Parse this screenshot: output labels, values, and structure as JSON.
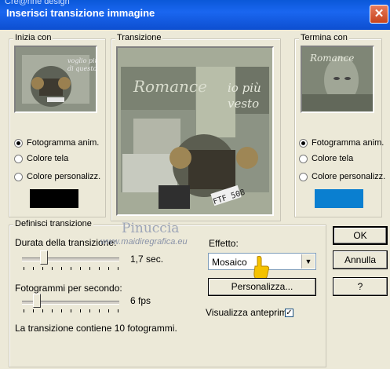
{
  "window": {
    "background_title": "Cre@nne design",
    "title": "Inserisci transizione immagine",
    "close_glyph": "✕"
  },
  "start_group": {
    "legend": "Inizia con",
    "preview_texts": [
      "voglio più",
      "di questo"
    ],
    "options": [
      "Fotogramma anim.",
      "Colore tela",
      "Colore personalizz."
    ],
    "selected_index": 0,
    "swatch_color": "#000000"
  },
  "transition_group": {
    "legend": "Transizione",
    "preview_texts": [
      "Romance",
      "io più",
      "vesto",
      "FTF 508"
    ]
  },
  "end_group": {
    "legend": "Termina con",
    "preview_text": "Romance",
    "options": [
      "Fotogramma anim.",
      "Colore tela",
      "Colore personalizz."
    ],
    "selected_index": 0,
    "swatch_color": "#0a7fd0"
  },
  "define_group": {
    "legend": "Definisci transizione",
    "duration_label": "Durata della transizione:",
    "duration_value": "1,7 sec.",
    "duration_fraction": 0.24,
    "fps_label": "Fotogrammi per secondo:",
    "fps_value": "6 fps",
    "fps_fraction": 0.16,
    "info_text": "La transizione contiene 10 fotogrammi.",
    "effect_label": "Effetto:",
    "effect_value": "Mosaico",
    "customize_label": "Personalizza...",
    "preview_label": "Visualizza anteprima",
    "preview_checked": true
  },
  "buttons": {
    "ok": "OK",
    "cancel": "Annulla",
    "help": "?"
  },
  "watermark": {
    "name": "Pinuccia",
    "site": "www.maidiregrafica.eu"
  },
  "colors": {
    "title_bar": "#0d55e0",
    "dialog_bg": "#ece9d8",
    "pointer_hand": "#f5c200"
  }
}
